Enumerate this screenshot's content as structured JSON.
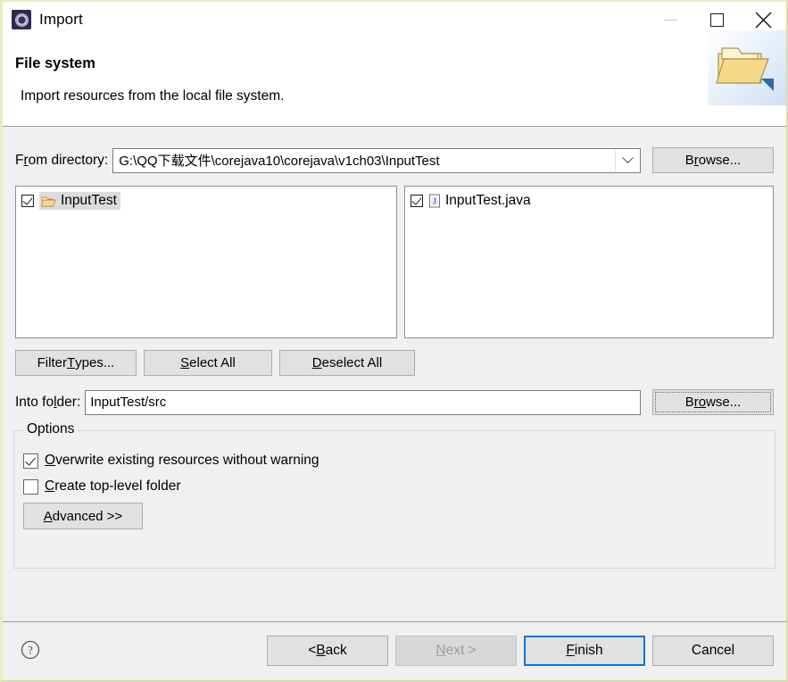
{
  "window": {
    "title": "Import",
    "icon": "eclipse-import-icon",
    "controls": {
      "minimize": "minimize-icon",
      "maximize": "maximize-icon",
      "close": "close-icon"
    }
  },
  "header": {
    "title": "File system",
    "description": "Import resources from the local file system.",
    "banner_icon": "open-folder-icon"
  },
  "from_directory": {
    "label_pre": "F",
    "label_mnemonic": "r",
    "label_post": "om directory:",
    "value": "G:\\QQ下载文件\\corejava10\\corejava\\v1ch03\\InputTest",
    "dropdown_icon": "chevron-down-icon",
    "browse": {
      "pre": "B",
      "mnemonic": "r",
      "post": "owse..."
    }
  },
  "left_tree": {
    "items": [
      {
        "label": "InputTest",
        "checked": true,
        "selected": true,
        "icon": "folder-open-icon"
      }
    ]
  },
  "right_tree": {
    "items": [
      {
        "label": "InputTest.java",
        "checked": true,
        "selected": false,
        "icon": "java-file-icon"
      }
    ]
  },
  "selection_buttons": [
    {
      "name": "filter-types-button",
      "pre": "Filter ",
      "mnemonic": "T",
      "post": "ypes..."
    },
    {
      "name": "select-all-button",
      "pre": "",
      "mnemonic": "S",
      "post": "elect All"
    },
    {
      "name": "deselect-all-button",
      "pre": "",
      "mnemonic": "D",
      "post": "eselect All"
    }
  ],
  "into_folder": {
    "label_pre": "Into fo",
    "label_mnemonic": "l",
    "label_post": "der:",
    "value": "InputTest/src",
    "browse": {
      "pre": "B",
      "mnemonic": "ro",
      "post": "wse..."
    }
  },
  "options": {
    "title": "Options",
    "checkboxes": [
      {
        "pre": "",
        "mnemonic": "O",
        "post": "verwrite existing resources without warning",
        "checked": true
      },
      {
        "pre": "",
        "mnemonic": "C",
        "post": "reate top-level folder",
        "checked": false
      }
    ],
    "advanced": {
      "pre": "",
      "mnemonic": "A",
      "post": "dvanced >>"
    }
  },
  "bottom": {
    "help_icon": "help-question-icon",
    "buttons": [
      {
        "name": "back-button",
        "pre": "< ",
        "mnemonic": "B",
        "post": "ack",
        "enabled": true,
        "default": false
      },
      {
        "name": "next-button",
        "pre": "",
        "mnemonic": "N",
        "post": "ext >",
        "enabled": false,
        "default": false
      },
      {
        "name": "finish-button",
        "pre": "",
        "mnemonic": "F",
        "post": "inish",
        "enabled": true,
        "default": true
      },
      {
        "name": "cancel-button",
        "pre": "",
        "mnemonic": "",
        "post": "Cancel",
        "enabled": true,
        "default": false
      }
    ]
  },
  "colors": {
    "window_border": "#e8ecc0",
    "body_bg": "#f0f0f0",
    "default_button_border": "#0078d7",
    "selection_bg": "#dcdcdc"
  }
}
